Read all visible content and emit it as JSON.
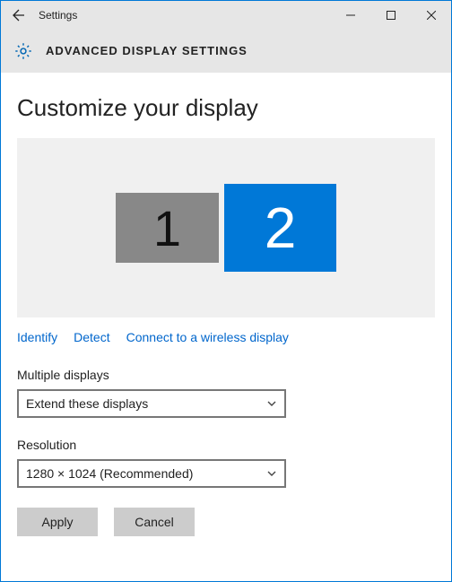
{
  "titlebar": {
    "app_name": "Settings"
  },
  "header": {
    "title": "ADVANCED DISPLAY SETTINGS"
  },
  "page": {
    "title": "Customize your display"
  },
  "monitors": {
    "m1": "1",
    "m2": "2"
  },
  "links": {
    "identify": "Identify",
    "detect": "Detect",
    "wireless": "Connect to a wireless display"
  },
  "multiple_displays": {
    "label": "Multiple displays",
    "value": "Extend these displays"
  },
  "resolution": {
    "label": "Resolution",
    "value": "1280 × 1024 (Recommended)"
  },
  "buttons": {
    "apply": "Apply",
    "cancel": "Cancel"
  }
}
